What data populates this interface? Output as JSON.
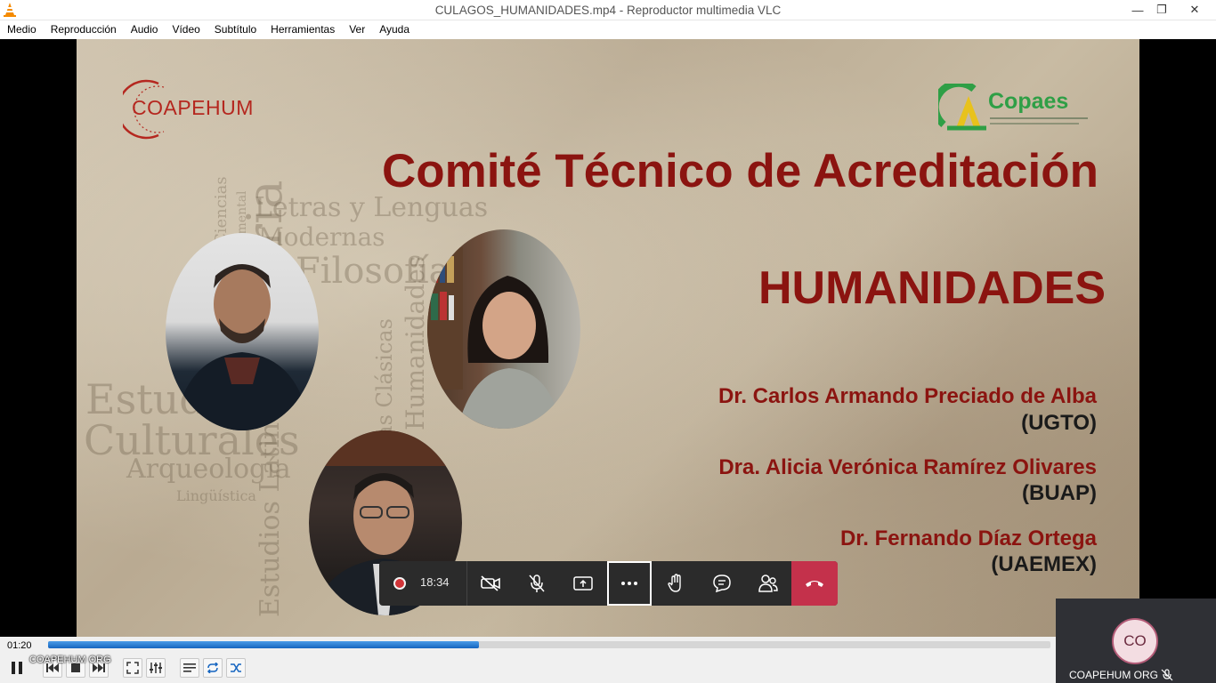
{
  "window": {
    "title": "CULAGOS_HUMANIDADES.mp4 - Reproductor multimedia VLC",
    "minimize_symbol": "—",
    "maximize_symbol": "❐",
    "close_symbol": "✕"
  },
  "menu": [
    "Medio",
    "Reproducción",
    "Audio",
    "Vídeo",
    "Subtítulo",
    "Herramientas",
    "Ver",
    "Ayuda"
  ],
  "slide": {
    "left_logo": "COAPEHUM",
    "right_logo": "Copaes",
    "title": "Comité Técnico de Acreditación",
    "subtitle": "HUMANIDADES",
    "people": [
      {
        "name": "Dr. Carlos Armando Preciado de Alba",
        "institution": "(UGTO)"
      },
      {
        "name": "Dra. Alicia Verónica Ramírez Olivares",
        "institution": "(BUAP)"
      },
      {
        "name": "Dr. Fernando Díaz Ortega",
        "institution": "(UAEMEX)"
      }
    ],
    "watermark_words": [
      "Letras y Lenguas",
      "Modernas",
      "Filosofía",
      "Historia",
      "Letras Clásicas",
      "Humanidades",
      "Estudios",
      "Culturales",
      "Arqueología",
      "Lingüística",
      "Estudios Latinoamericanos",
      "Ciencias",
      "Documental"
    ]
  },
  "meeting": {
    "timer": "18:34",
    "buttons": [
      "camera-off",
      "mic-off",
      "share",
      "more",
      "raise-hand",
      "chat",
      "participants",
      "hang-up"
    ]
  },
  "player": {
    "elapsed": "01:20",
    "progress": 0.43,
    "overlay_name": "COAPEHUM ORG"
  },
  "self_view": {
    "initials": "CO",
    "name": "COAPEHUM ORG"
  },
  "colors": {
    "title_red": "#8b1410",
    "hangup": "#c4314b",
    "seek_blue": "#1565c0"
  }
}
